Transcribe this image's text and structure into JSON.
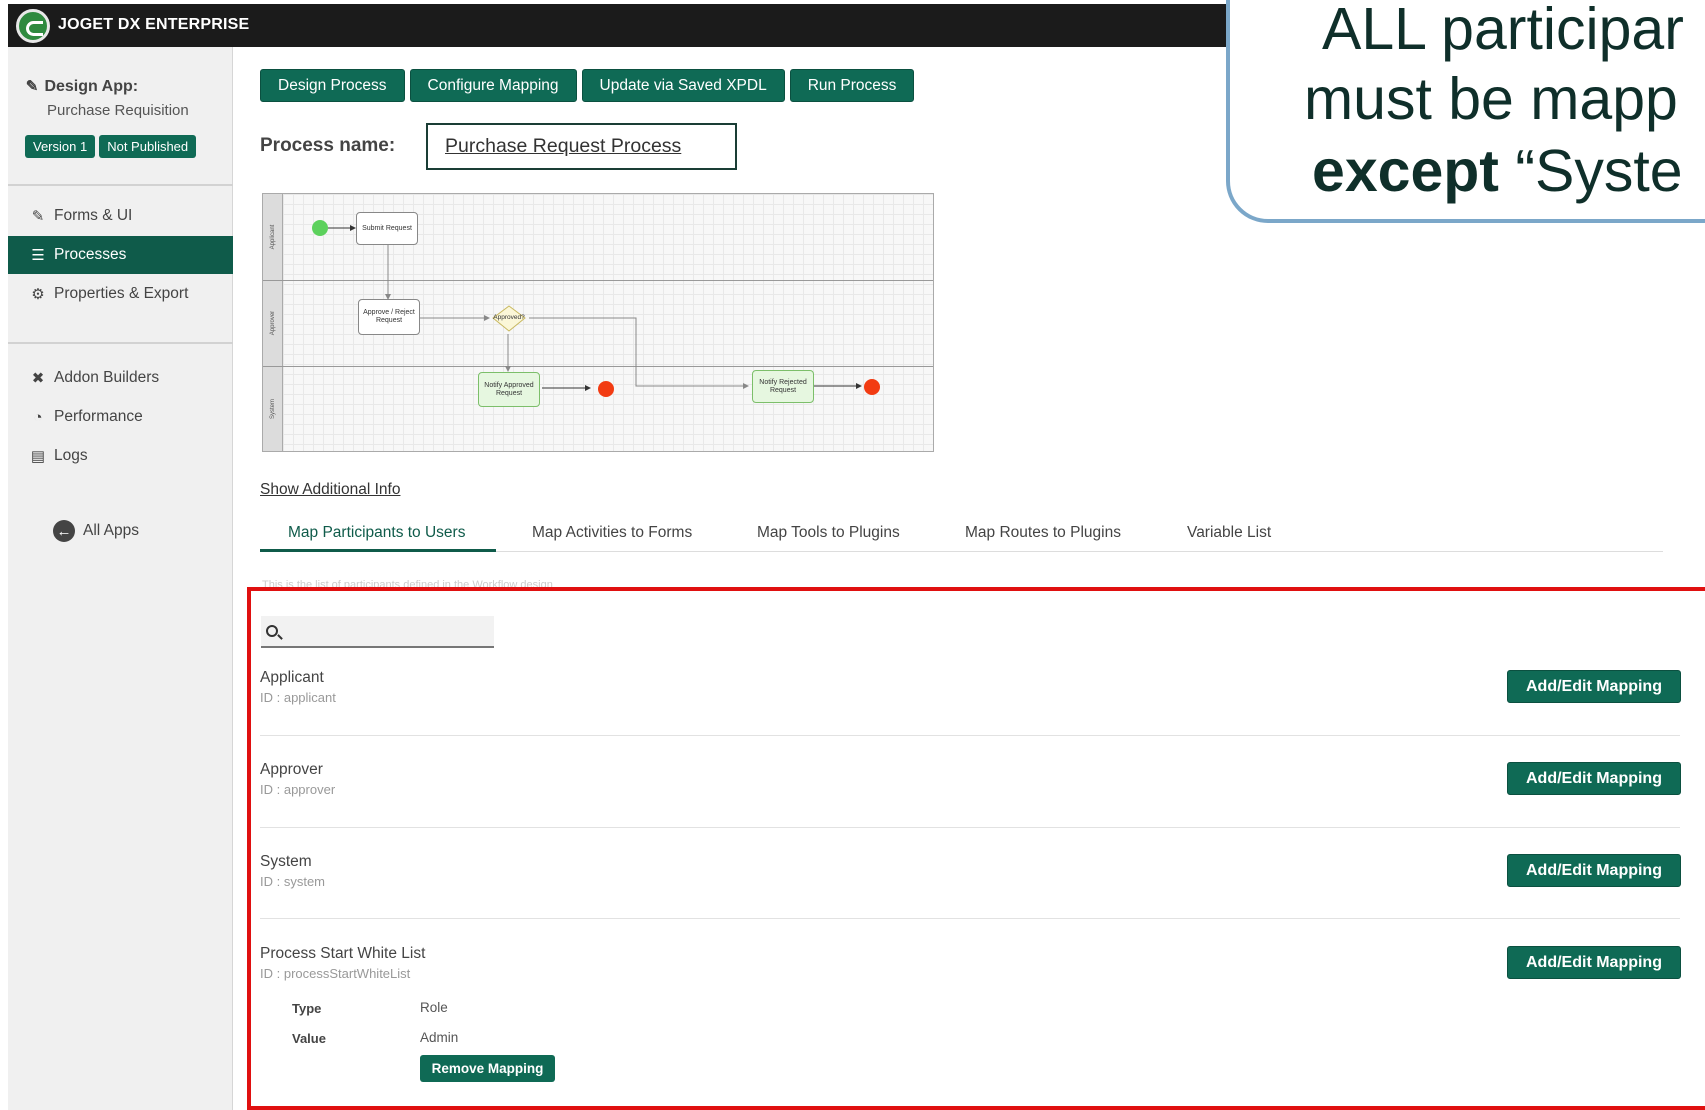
{
  "header": {
    "brand": "JOGET DX ENTERPRISE"
  },
  "sidebar": {
    "design_app_label": "Design App:",
    "app_name": "Purchase Requisition",
    "version_badge": "Version 1",
    "status_badge": "Not Published",
    "items": [
      {
        "label": "Forms & UI",
        "icon": "edit-icon"
      },
      {
        "label": "Processes",
        "icon": "list-icon",
        "active": true
      },
      {
        "label": "Properties & Export",
        "icon": "gear-icon"
      },
      {
        "label": "Addon Builders",
        "icon": "tools-icon"
      },
      {
        "label": "Performance",
        "icon": "gauge-icon"
      },
      {
        "label": "Logs",
        "icon": "scroll-icon"
      }
    ],
    "all_apps": "All Apps"
  },
  "toolbar": {
    "buttons": [
      "Design Process",
      "Configure Mapping",
      "Update via Saved XPDL",
      "Run Process"
    ]
  },
  "process": {
    "name_label": "Process name:",
    "name_value": "Purchase Request Process"
  },
  "diagram": {
    "lanes": [
      "Applicant",
      "Approver",
      "System"
    ],
    "nodes": {
      "submit": "Submit Request",
      "approve": "Approve / Reject Request",
      "decision": "Approved?",
      "notify_approved": "Notify Approved Request",
      "notify_rejected": "Notify Rejected Request"
    }
  },
  "show_info": "Show Additional Info",
  "tabs": [
    "Map Participants to Users",
    "Map Activities to Forms",
    "Map Tools to Plugins",
    "Map Routes to Plugins",
    "Variable List"
  ],
  "faint_note": "This is the list of participants defined in the Workflow design",
  "participants": [
    {
      "name": "Applicant",
      "id": "ID : applicant",
      "button": "Add/Edit Mapping"
    },
    {
      "name": "Approver",
      "id": "ID : approver",
      "button": "Add/Edit Mapping"
    },
    {
      "name": "System",
      "id": "ID : system",
      "button": "Add/Edit Mapping"
    },
    {
      "name": "Process Start White List",
      "id": "ID : processStartWhiteList",
      "button": "Add/Edit Mapping",
      "mapping": {
        "type_label": "Type",
        "type_value": "Role",
        "value_label": "Value",
        "value_value": "Admin",
        "remove_button": "Remove Mapping"
      }
    }
  ],
  "callout": {
    "line1": "ALL participar",
    "line2": "must be mapp",
    "line3_bold": "except",
    "line3_rest": " “Syste"
  },
  "colors": {
    "primary": "#0f6a55",
    "highlight": "#e01010",
    "callout_border": "#7ba7c9"
  }
}
